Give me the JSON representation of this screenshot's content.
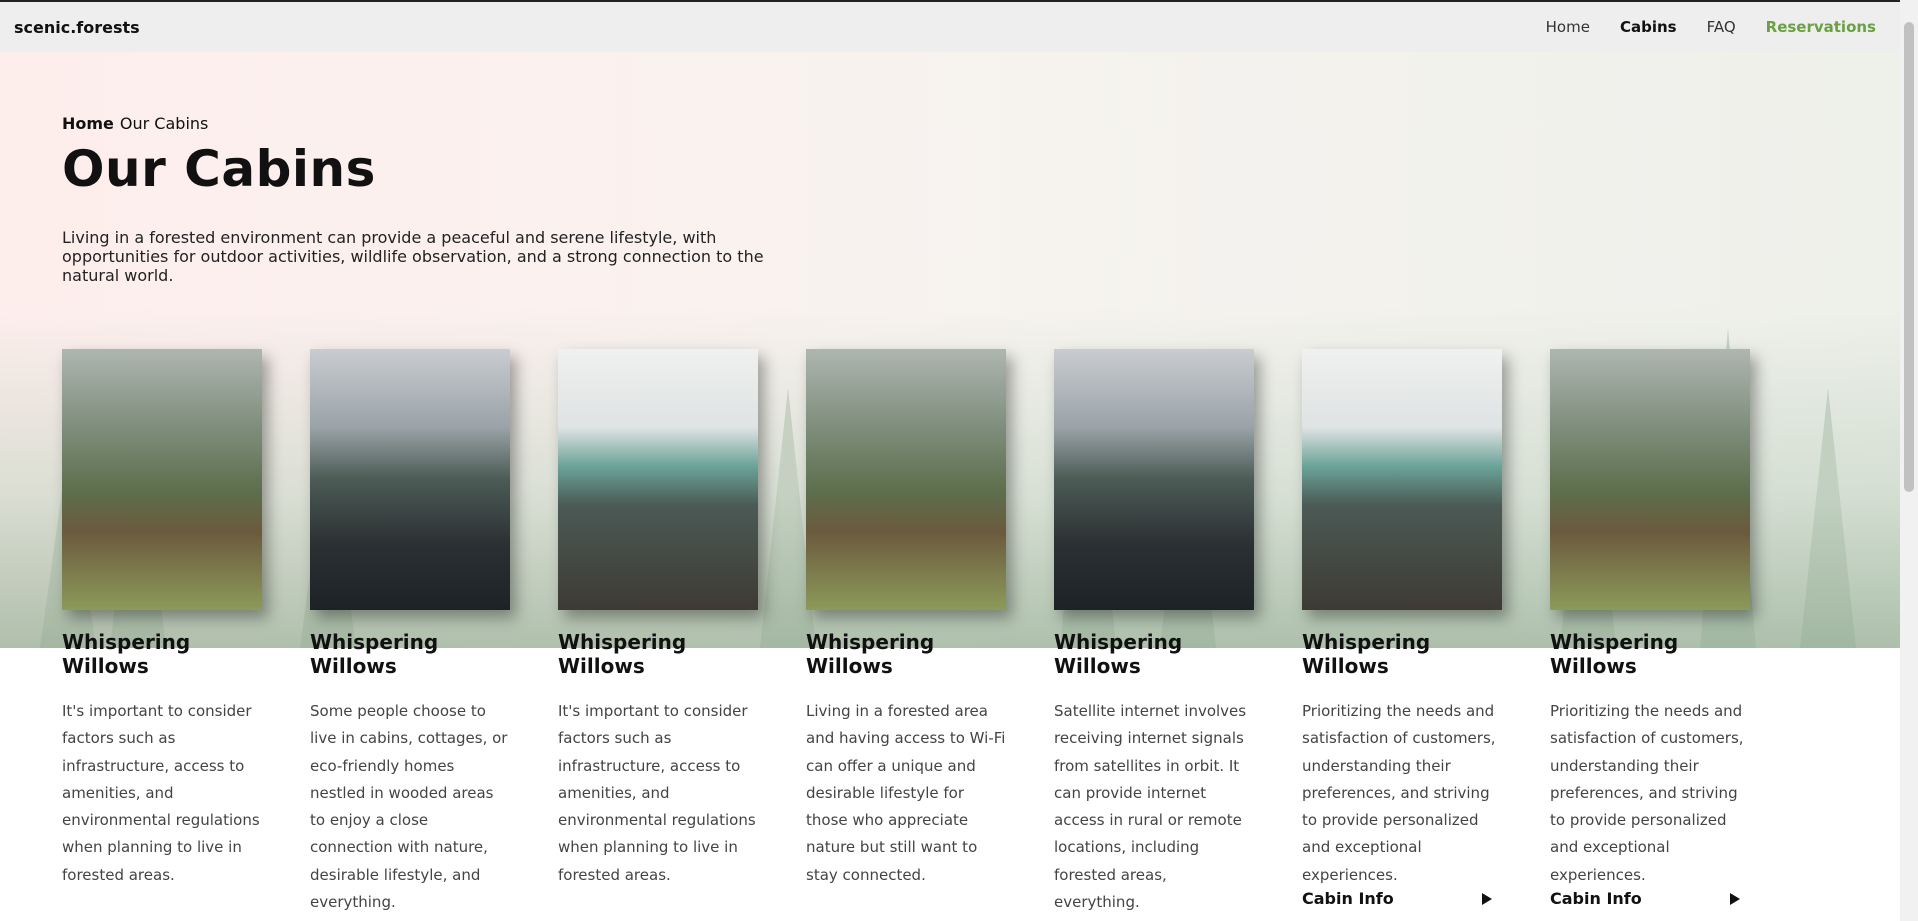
{
  "header": {
    "logo": "scenic.forests",
    "nav": [
      {
        "label": "Home",
        "state": "normal"
      },
      {
        "label": "Cabins",
        "state": "active"
      },
      {
        "label": "FAQ",
        "state": "normal"
      },
      {
        "label": "Reservations",
        "state": "accent"
      }
    ]
  },
  "colors": {
    "accent": "#6ba043",
    "topbar": "#eeeeee"
  },
  "breadcrumb": {
    "home": "Home",
    "current": "Our Cabins"
  },
  "page_title": "Our Cabins",
  "intro": "Living in a forested environment can provide a peaceful and serene lifestyle, with opportunities for outdoor activities, wildlife observation, and a strong connection to the natural world.",
  "cards": [
    {
      "image": "cabin-in-forest",
      "title": "Whispering Willows",
      "text": "It's important to consider factors such as infrastructure, access to amenities, and environmental regulations when planning to live in forested areas.",
      "link": ""
    },
    {
      "image": "lake-lodge-snow",
      "title": "Whispering Willows",
      "text": "Some people choose to live in cabins, cottages, or eco-friendly homes nestled in wooded areas to enjoy a close connection with nature, desirable lifestyle, and everything.",
      "link": ""
    },
    {
      "image": "mountain-sheds",
      "title": "Whispering Willows",
      "text": "It's important to consider factors such as infrastructure, access to amenities, and environmental regulations when planning to live in forested areas.",
      "link": ""
    },
    {
      "image": "cabin-in-forest",
      "title": "Whispering Willows",
      "text": "Living in a forested area and having access to Wi-Fi can offer a unique and desirable lifestyle for those who appreciate nature but still want to stay connected.",
      "link": ""
    },
    {
      "image": "lake-lodge-snow",
      "title": "Whispering Willows",
      "text": "Satellite internet involves receiving internet signals from satellites in orbit. It can provide internet access in rural or remote locations, including forested areas, everything.",
      "link": ""
    },
    {
      "image": "mountain-sheds",
      "title": "Whispering Willows",
      "text": "Prioritizing the needs and satisfaction of customers, understanding their preferences, and striving to provide personalized and exceptional experiences.",
      "link": "Cabin Info"
    },
    {
      "image": "cabin-in-forest",
      "title": "Whispering Willows",
      "text": "Prioritizing the needs and satisfaction of customers, understanding their preferences, and striving to provide personalized and exceptional experiences.",
      "link": "Cabin Info"
    }
  ]
}
